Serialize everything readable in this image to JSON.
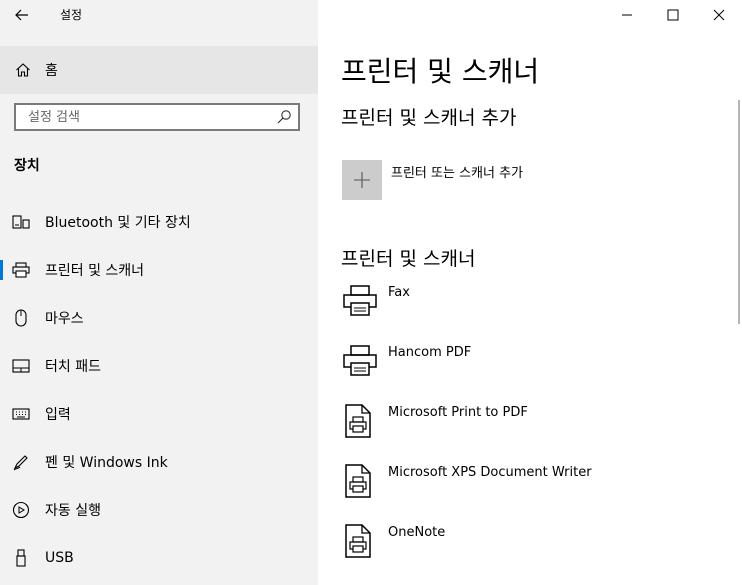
{
  "app_title": "설정",
  "sidebar": {
    "home_label": "홈",
    "search_placeholder": "설정 검색",
    "section": "장치",
    "items": [
      {
        "label": "Bluetooth 및 기타 장치",
        "icon": "bluetooth-devices-icon"
      },
      {
        "label": "프린터 및 스캐너",
        "icon": "printer-icon",
        "active": true
      },
      {
        "label": "마우스",
        "icon": "mouse-icon"
      },
      {
        "label": "터치 패드",
        "icon": "touchpad-icon"
      },
      {
        "label": "입력",
        "icon": "keyboard-icon"
      },
      {
        "label": "펜 및 Windows Ink",
        "icon": "pen-icon"
      },
      {
        "label": "자동 실행",
        "icon": "autoplay-icon"
      },
      {
        "label": "USB",
        "icon": "usb-icon"
      }
    ]
  },
  "main": {
    "title": "프린터 및 스캐너",
    "add_section_title": "프린터 및 스캐너 추가",
    "add_button_label": "프린터 또는 스캐너 추가",
    "list_section_title": "프린터 및 스캐너",
    "printers": [
      {
        "name": "Fax",
        "icon": "printer-icon"
      },
      {
        "name": "Hancom PDF",
        "icon": "printer-icon"
      },
      {
        "name": "Microsoft Print to PDF",
        "icon": "printer-document-icon"
      },
      {
        "name": "Microsoft XPS Document Writer",
        "icon": "printer-document-icon"
      },
      {
        "name": "OneNote",
        "icon": "printer-document-icon"
      }
    ]
  },
  "colors": {
    "accent": "#0078d7",
    "sidebar_bg": "#f2f2f2",
    "home_bg": "#e6e6e6",
    "tile_bg": "#cccccc"
  }
}
